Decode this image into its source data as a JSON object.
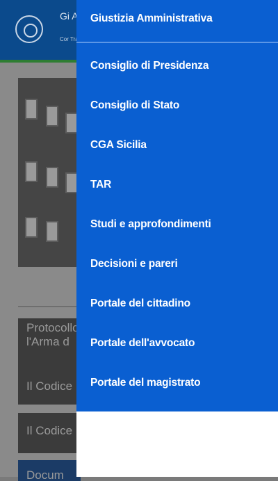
{
  "background": {
    "header_title_partial": "Gi Ar",
    "header_subtitle_partial": "Cor Tra",
    "list_items": [
      "Protocollo l'Arma d",
      "Il Codice",
      "Il Codice",
      "Docum"
    ]
  },
  "menu": {
    "header_item": "Giustizia Amministrativa",
    "items": [
      "Consiglio di Presidenza",
      "Consiglio di Stato",
      "CGA Sicilia",
      "TAR",
      "Studi e approfondimenti",
      "Decisioni e pareri",
      "Portale del cittadino",
      "Portale dell'avvocato",
      "Portale del magistrato"
    ]
  },
  "colors": {
    "menu_bg": "#0a5fd1",
    "header_bg": "#0b4a8c"
  }
}
